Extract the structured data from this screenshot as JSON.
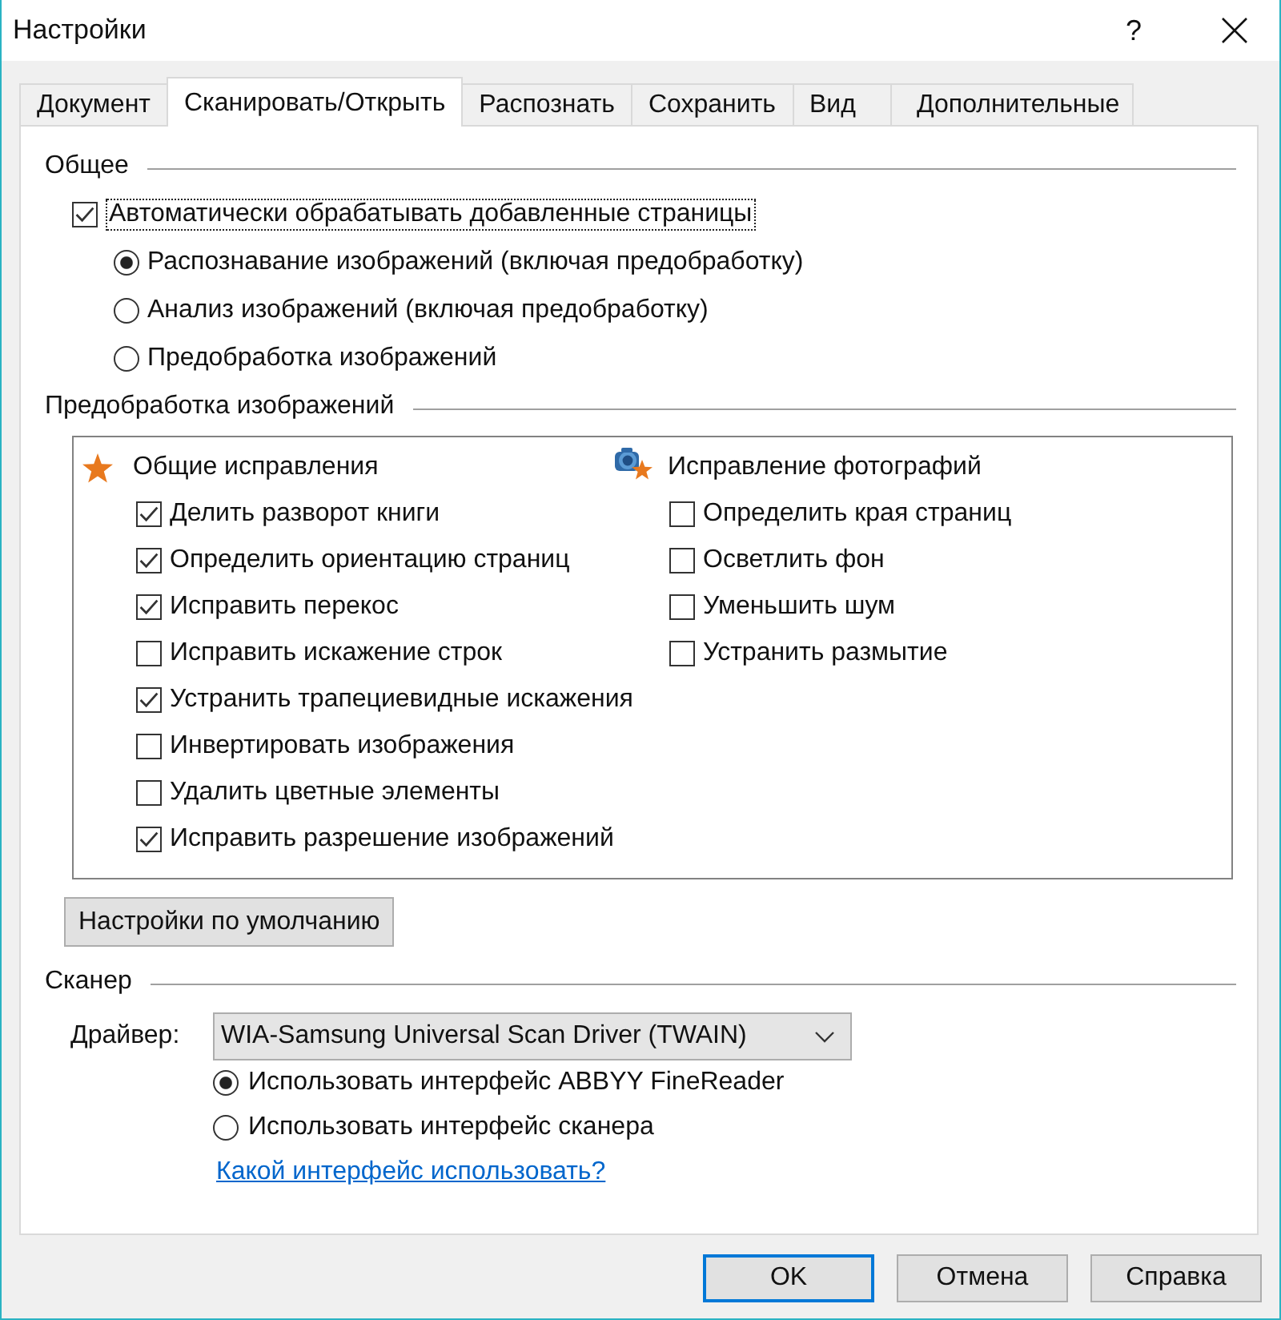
{
  "window": {
    "title": "Настройки",
    "help_button": "?"
  },
  "tabs": [
    {
      "label": "Документ",
      "selected": false
    },
    {
      "label": "Сканировать/Открыть",
      "selected": true
    },
    {
      "label": "Распознать",
      "selected": false
    },
    {
      "label": "Сохранить",
      "selected": false
    },
    {
      "label": "Вид",
      "selected": false
    },
    {
      "label": "Дополнительные",
      "selected": false
    }
  ],
  "general": {
    "heading": "Общее",
    "auto_process": {
      "label": "Автоматически обрабатывать добавленные страницы",
      "checked": true,
      "focused": true
    },
    "modes": [
      {
        "label": "Распознавание изображений (включая предобработку)",
        "selected": true
      },
      {
        "label": "Анализ изображений (включая предобработку)",
        "selected": false
      },
      {
        "label": "Предобработка изображений",
        "selected": false
      }
    ]
  },
  "preprocessing": {
    "heading": "Предобработка изображений",
    "groups": [
      {
        "kind": "general",
        "title": "Общие исправления",
        "options": [
          {
            "label": "Делить разворот книги",
            "checked": true
          },
          {
            "label": "Определить ориентацию страниц",
            "checked": true
          },
          {
            "label": "Исправить перекос",
            "checked": true
          },
          {
            "label": "Исправить искажение строк",
            "checked": false
          },
          {
            "label": "Устранить трапециевидные искажения",
            "checked": true
          },
          {
            "label": "Инвертировать изображения",
            "checked": false
          },
          {
            "label": "Удалить цветные элементы",
            "checked": false
          },
          {
            "label": "Исправить разрешение изображений",
            "checked": true
          }
        ]
      },
      {
        "kind": "photo",
        "title": "Исправление фотографий",
        "options": [
          {
            "label": "Определить края страниц",
            "checked": false
          },
          {
            "label": "Осветлить фон",
            "checked": false
          },
          {
            "label": "Уменьшить шум",
            "checked": false
          },
          {
            "label": "Устранить размытие",
            "checked": false
          }
        ]
      }
    ],
    "reset_button": "Настройки по умолчанию"
  },
  "scanner": {
    "heading": "Сканер",
    "driver": {
      "label": "Драйвер:",
      "value": "WIA-Samsung Universal Scan Driver (TWAIN)"
    },
    "interfaces": [
      {
        "label": "Использовать интерфейс ABBYY FineReader",
        "selected": true
      },
      {
        "label": "Использовать интерфейс сканера",
        "selected": false
      }
    ],
    "help_link": "Какой интерфейс использовать?"
  },
  "buttons": [
    {
      "label": "OK",
      "default": true
    },
    {
      "label": "Отмена",
      "default": false
    },
    {
      "label": "Справка",
      "default": false
    }
  ]
}
